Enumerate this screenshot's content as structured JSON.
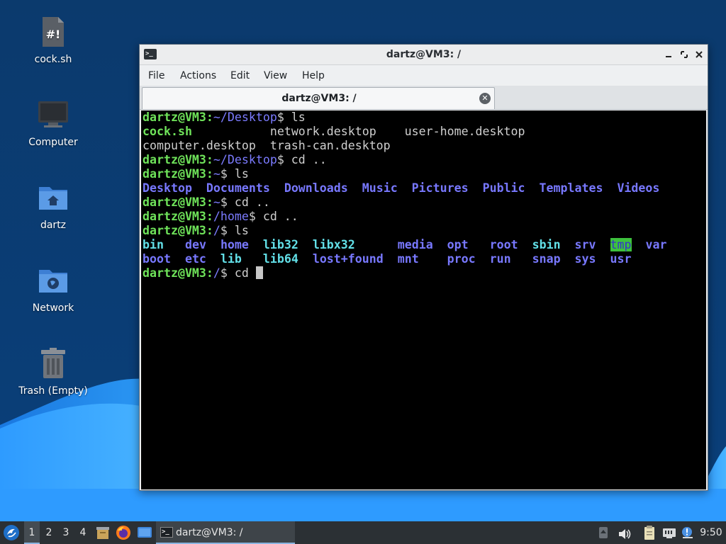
{
  "desktop": {
    "icons": [
      {
        "label": "cock.sh",
        "icon": "script-file-icon"
      },
      {
        "label": "Computer",
        "icon": "computer-icon"
      },
      {
        "label": "dartz",
        "icon": "home-folder-icon"
      },
      {
        "label": "Network",
        "icon": "network-folder-icon"
      },
      {
        "label": "Trash (Empty)",
        "icon": "trash-icon"
      }
    ],
    "script_glyph": "#!"
  },
  "window": {
    "title": "dartz@VM3: /",
    "icon_glyph": ">_",
    "menu": [
      "File",
      "Actions",
      "Edit",
      "View",
      "Help"
    ],
    "tab_title": "dartz@VM3: /"
  },
  "terminal": {
    "user": "dartz@VM3",
    "lines": [
      {
        "prompt_path": "~/Desktop",
        "cmd": " ls"
      },
      {
        "out": [
          [
            "cock.sh",
            "ex"
          ],
          [
            "           ",
            "t"
          ],
          [
            "network.desktop    user-home.desktop",
            "t"
          ]
        ]
      },
      {
        "out": [
          [
            "computer.desktop  trash-can.desktop",
            "t"
          ]
        ]
      },
      {
        "prompt_path": "~/Desktop",
        "cmd": " cd .."
      },
      {
        "prompt_path": "~",
        "cmd": " ls"
      },
      {
        "out": [
          [
            "Desktop",
            "di"
          ],
          [
            "  ",
            "t"
          ],
          [
            "Documents",
            "di"
          ],
          [
            "  ",
            "t"
          ],
          [
            "Downloads",
            "di"
          ],
          [
            "  ",
            "t"
          ],
          [
            "Music",
            "di"
          ],
          [
            "  ",
            "t"
          ],
          [
            "Pictures",
            "di"
          ],
          [
            "  ",
            "t"
          ],
          [
            "Public",
            "di"
          ],
          [
            "  ",
            "t"
          ],
          [
            "Templates",
            "di"
          ],
          [
            "  ",
            "t"
          ],
          [
            "Videos",
            "di"
          ]
        ]
      },
      {
        "prompt_path": "~",
        "cmd": " cd .."
      },
      {
        "prompt_path": "/home",
        "cmd": " cd .."
      },
      {
        "prompt_path": "/",
        "cmd": " ls"
      },
      {
        "out": [
          [
            "bin",
            "ln"
          ],
          [
            "   ",
            "t"
          ],
          [
            "dev",
            "di"
          ],
          [
            "  ",
            "t"
          ],
          [
            "home",
            "di"
          ],
          [
            "  ",
            "t"
          ],
          [
            "lib32",
            "ln"
          ],
          [
            "  ",
            "t"
          ],
          [
            "libx32",
            "ln"
          ],
          [
            "      ",
            "t"
          ],
          [
            "media",
            "di"
          ],
          [
            "  ",
            "t"
          ],
          [
            "opt",
            "di"
          ],
          [
            "   ",
            "t"
          ],
          [
            "root",
            "di"
          ],
          [
            "  ",
            "t"
          ],
          [
            "sbin",
            "ln"
          ],
          [
            "  ",
            "t"
          ],
          [
            "srv",
            "di"
          ],
          [
            "  ",
            "t"
          ],
          [
            "tmp",
            "hl"
          ],
          [
            "  ",
            "t"
          ],
          [
            "var",
            "di"
          ]
        ]
      },
      {
        "out": [
          [
            "boot",
            "di"
          ],
          [
            "  ",
            "t"
          ],
          [
            "etc",
            "di"
          ],
          [
            "  ",
            "t"
          ],
          [
            "lib",
            "ln"
          ],
          [
            "   ",
            "t"
          ],
          [
            "lib64",
            "ln"
          ],
          [
            "  ",
            "t"
          ],
          [
            "lost+found",
            "di"
          ],
          [
            "  ",
            "t"
          ],
          [
            "mnt",
            "di"
          ],
          [
            "    ",
            "t"
          ],
          [
            "proc",
            "di"
          ],
          [
            "  ",
            "t"
          ],
          [
            "run",
            "di"
          ],
          [
            "   ",
            "t"
          ],
          [
            "snap",
            "di"
          ],
          [
            "  ",
            "t"
          ],
          [
            "sys",
            "di"
          ],
          [
            "  ",
            "t"
          ],
          [
            "usr",
            "di"
          ]
        ]
      },
      {
        "prompt_path": "/",
        "cmd": " cd ",
        "cursor": true
      }
    ]
  },
  "taskbar": {
    "workspaces": [
      "1",
      "2",
      "3",
      "4"
    ],
    "active_workspace": "1",
    "task_label": "dartz@VM3: /",
    "clock": "9:50",
    "colors": {
      "accent": "#8ab4e0",
      "panel": "#2b3034"
    }
  }
}
